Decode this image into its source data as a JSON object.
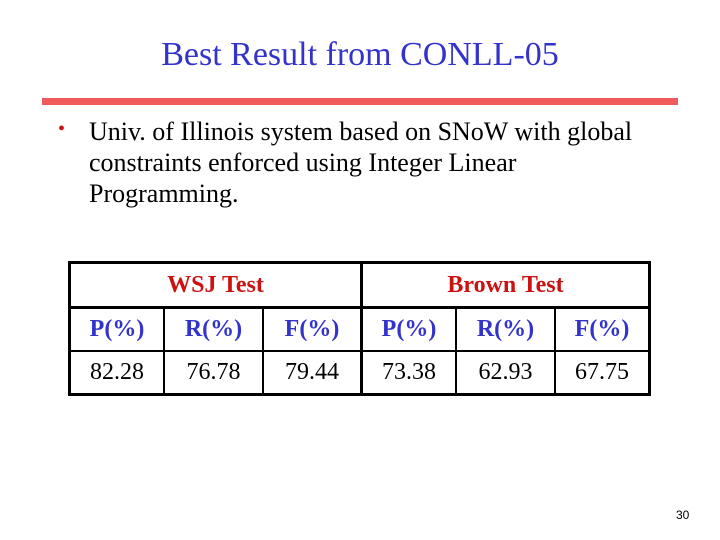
{
  "slide": {
    "title": "Best Result from CONLL-05",
    "bullets": [
      {
        "icon": "bullet-dot-icon",
        "text": "Univ. of Illinois system based on SNoW with global constraints enforced using Integer Linear Programming."
      }
    ],
    "page_number": "30"
  },
  "results_table": {
    "groups": [
      "WSJ Test",
      "Brown Test"
    ],
    "columns": [
      "P(%)",
      "R(%)",
      "F(%)",
      "P(%)",
      "R(%)",
      "F(%)"
    ],
    "values": [
      "82.28",
      "76.78",
      "79.44",
      "73.38",
      "62.93",
      "67.75"
    ]
  },
  "colors": {
    "title": "#3333cc",
    "rule": "#f05a5a",
    "group_header": "#cc1111",
    "column_header": "#3333cc",
    "bullet": "#cc1111"
  }
}
